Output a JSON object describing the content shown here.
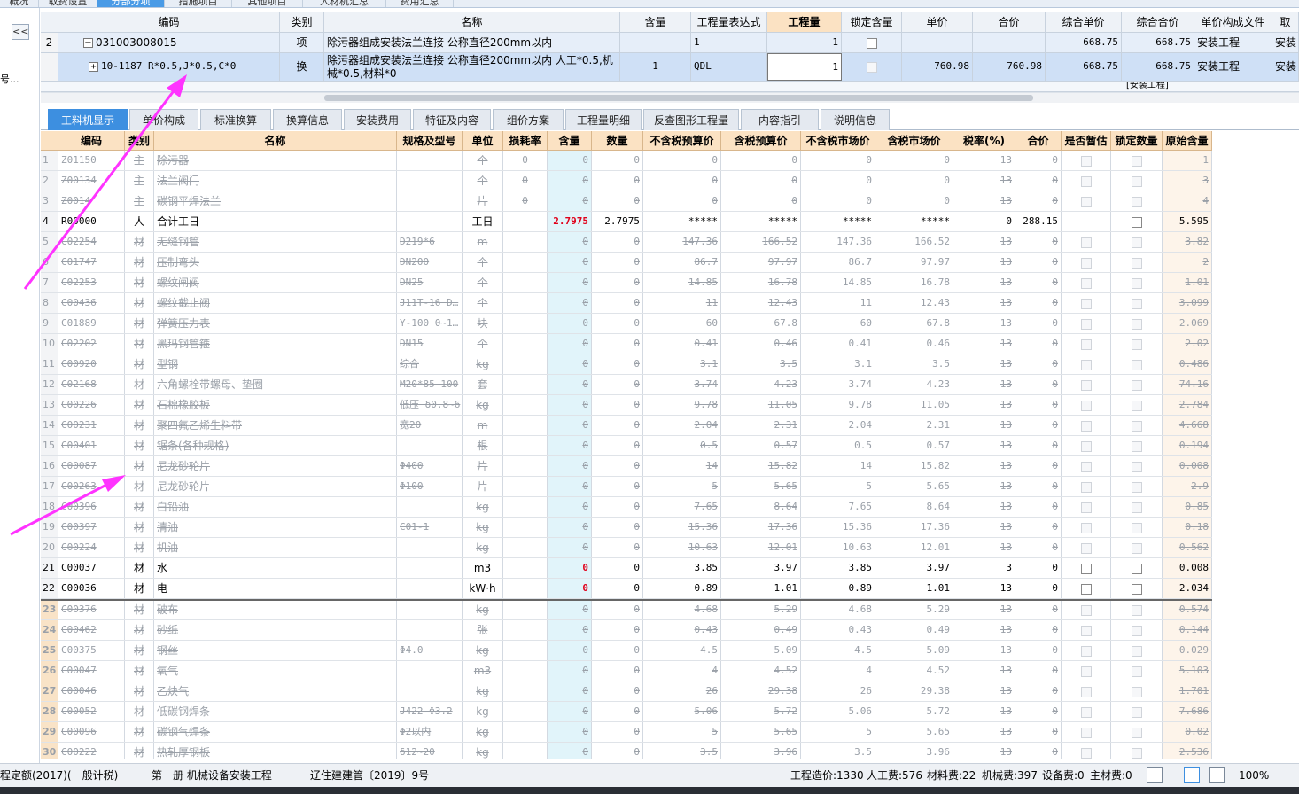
{
  "top_tabs": [
    "概况",
    "取费设置",
    "分部分项",
    "措施项目",
    "其他项目",
    "人材机汇总",
    "费用汇总"
  ],
  "left_panel": {
    "collapse_label": "<<",
    "side_text": "号..."
  },
  "upper_table": {
    "headers": [
      "编码",
      "类别",
      "名称",
      "含量",
      "工程量表达式",
      "工程量",
      "锁定含量",
      "单价",
      "合价",
      "综合单价",
      "综合合价",
      "单价构成文件",
      "取"
    ],
    "rows": [
      {
        "idx": "2",
        "code": "031003008015",
        "type": "项",
        "name": "除污器组成安装法兰连接 公称直径200mm以内",
        "qty_ratio": "",
        "expr": "1",
        "qty": "1",
        "unit_price": "",
        "total": "",
        "comp_unit": "668.75",
        "comp_total": "668.75",
        "file": "安装工程",
        "extra": "安装"
      },
      {
        "idx": "",
        "code": "10-1187 R*0.5,J*0.5,C*0",
        "type": "换",
        "name": "除污器组成安装法兰连接 公称直径200mm以内  人工*0.5,机械*0.5,材料*0",
        "qty_ratio": "1",
        "expr": "QDL",
        "qty": "1",
        "unit_price": "760.98",
        "total": "760.98",
        "comp_unit": "668.75",
        "comp_total": "668.75",
        "file": "安装工程",
        "extra": "安装"
      }
    ],
    "partial_row_text": "[安装工程]"
  },
  "lower_tabs": [
    "工料机显示",
    "单价构成",
    "标准换算",
    "换算信息",
    "安装费用",
    "特征及内容",
    "组价方案",
    "工程量明细",
    "反查图形工程量",
    "内容指引",
    "说明信息"
  ],
  "grid": {
    "headers": [
      "",
      "编码",
      "类别",
      "名称",
      "规格及型号",
      "单位",
      "损耗率",
      "含量",
      "数量",
      "不含税预算价",
      "含税预算价",
      "不含税市场价",
      "含税市场价",
      "税率(%)",
      "合价",
      "是否暂估",
      "锁定数量",
      "原始含量"
    ],
    "rows": [
      {
        "idx": "1",
        "code": "Z01150",
        "type": "主",
        "name": "除污器",
        "spec": "",
        "unit": "个",
        "loss": "0",
        "ratio": "0",
        "qty": "0",
        "bp": "0",
        "bpt": "0",
        "mp": "0",
        "mpt": "0",
        "tax": "13",
        "total": "0",
        "orig": "1",
        "faded": true,
        "bold_idx": false
      },
      {
        "idx": "2",
        "code": "Z00134",
        "type": "主",
        "name": "法兰阀门",
        "spec": "",
        "unit": "个",
        "loss": "0",
        "ratio": "0",
        "qty": "0",
        "bp": "0",
        "bpt": "0",
        "mp": "0",
        "mpt": "0",
        "tax": "13",
        "total": "0",
        "orig": "3",
        "faded": true,
        "bold_idx": false
      },
      {
        "idx": "3",
        "code": "Z0014",
        "type": "主",
        "name": "碳钢平焊法兰",
        "spec": "",
        "unit": "片",
        "loss": "0",
        "ratio": "0",
        "qty": "0",
        "bp": "0",
        "bpt": "0",
        "mp": "0",
        "mpt": "0",
        "tax": "13",
        "total": "0",
        "orig": "4",
        "faded": true,
        "bold_idx": false
      },
      {
        "idx": "4",
        "code": "R00000",
        "type": "人",
        "name": "合计工日",
        "spec": "",
        "unit": "工日",
        "loss": "",
        "ratio": "2.7975",
        "qty": "2.7975",
        "bp": "*****",
        "bpt": "*****",
        "mp": "*****",
        "mpt": "*****",
        "tax": "0",
        "total": "288.15",
        "orig": "5.595",
        "faded": false,
        "bold_idx": false,
        "ratio_red": true
      },
      {
        "idx": "5",
        "code": "C02254",
        "type": "材",
        "name": "无缝钢管",
        "spec": "D219*6",
        "unit": "m",
        "loss": "",
        "ratio": "0",
        "qty": "0",
        "bp": "147.36",
        "bpt": "166.52",
        "mp": "147.36",
        "mpt": "166.52",
        "tax": "13",
        "total": "0",
        "orig": "3.82",
        "faded": true,
        "bold_idx": false
      },
      {
        "idx": "6",
        "code": "C01747",
        "type": "材",
        "name": "压制弯头",
        "spec": "DN200",
        "unit": "个",
        "loss": "",
        "ratio": "0",
        "qty": "0",
        "bp": "86.7",
        "bpt": "97.97",
        "mp": "86.7",
        "mpt": "97.97",
        "tax": "13",
        "total": "0",
        "orig": "2",
        "faded": true,
        "bold_idx": false
      },
      {
        "idx": "7",
        "code": "C02253",
        "type": "材",
        "name": "螺纹闸阀",
        "spec": "DN25",
        "unit": "个",
        "loss": "",
        "ratio": "0",
        "qty": "0",
        "bp": "14.85",
        "bpt": "16.78",
        "mp": "14.85",
        "mpt": "16.78",
        "tax": "13",
        "total": "0",
        "orig": "1.01",
        "faded": true,
        "bold_idx": false
      },
      {
        "idx": "8",
        "code": "C00436",
        "type": "材",
        "name": "螺纹截止阀",
        "spec": "J11T-16 D…",
        "unit": "个",
        "loss": "",
        "ratio": "0",
        "qty": "0",
        "bp": "11",
        "bpt": "12.43",
        "mp": "11",
        "mpt": "12.43",
        "tax": "13",
        "total": "0",
        "orig": "3.099",
        "faded": true,
        "bold_idx": false
      },
      {
        "idx": "9",
        "code": "C01889",
        "type": "材",
        "name": "弹簧压力表",
        "spec": "Y-100 0~1…",
        "unit": "块",
        "loss": "",
        "ratio": "0",
        "qty": "0",
        "bp": "60",
        "bpt": "67.8",
        "mp": "60",
        "mpt": "67.8",
        "tax": "13",
        "total": "0",
        "orig": "2.069",
        "faded": true,
        "bold_idx": false
      },
      {
        "idx": "10",
        "code": "C02202",
        "type": "材",
        "name": "黑玛钢管箍",
        "spec": "DN15",
        "unit": "个",
        "loss": "",
        "ratio": "0",
        "qty": "0",
        "bp": "0.41",
        "bpt": "0.46",
        "mp": "0.41",
        "mpt": "0.46",
        "tax": "13",
        "total": "0",
        "orig": "2.02",
        "faded": true,
        "bold_idx": false
      },
      {
        "idx": "11",
        "code": "C00920",
        "type": "材",
        "name": "型钢",
        "spec": "综合",
        "unit": "kg",
        "loss": "",
        "ratio": "0",
        "qty": "0",
        "bp": "3.1",
        "bpt": "3.5",
        "mp": "3.1",
        "mpt": "3.5",
        "tax": "13",
        "total": "0",
        "orig": "0.486",
        "faded": true,
        "bold_idx": false
      },
      {
        "idx": "12",
        "code": "C02168",
        "type": "材",
        "name": "六角螺栓带螺母、垫圈",
        "spec": "M20*85~100",
        "unit": "套",
        "loss": "",
        "ratio": "0",
        "qty": "0",
        "bp": "3.74",
        "bpt": "4.23",
        "mp": "3.74",
        "mpt": "4.23",
        "tax": "13",
        "total": "0",
        "orig": "74.16",
        "faded": true,
        "bold_idx": false
      },
      {
        "idx": "13",
        "code": "C00226",
        "type": "材",
        "name": "石棉橡胶板",
        "spec": "低压 δ0.8~6",
        "unit": "kg",
        "loss": "",
        "ratio": "0",
        "qty": "0",
        "bp": "9.78",
        "bpt": "11.05",
        "mp": "9.78",
        "mpt": "11.05",
        "tax": "13",
        "total": "0",
        "orig": "2.784",
        "faded": true,
        "bold_idx": false
      },
      {
        "idx": "14",
        "code": "C00231",
        "type": "材",
        "name": "聚四氟乙烯生料带",
        "spec": "宽20",
        "unit": "m",
        "loss": "",
        "ratio": "0",
        "qty": "0",
        "bp": "2.04",
        "bpt": "2.31",
        "mp": "2.04",
        "mpt": "2.31",
        "tax": "13",
        "total": "0",
        "orig": "4.668",
        "faded": true,
        "bold_idx": false
      },
      {
        "idx": "15",
        "code": "C00401",
        "type": "材",
        "name": "锯条(各种规格)",
        "spec": "",
        "unit": "根",
        "loss": "",
        "ratio": "0",
        "qty": "0",
        "bp": "0.5",
        "bpt": "0.57",
        "mp": "0.5",
        "mpt": "0.57",
        "tax": "13",
        "total": "0",
        "orig": "0.194",
        "faded": true,
        "bold_idx": false
      },
      {
        "idx": "16",
        "code": "C00087",
        "type": "材",
        "name": "尼龙砂轮片",
        "spec": "Φ400",
        "unit": "片",
        "loss": "",
        "ratio": "0",
        "qty": "0",
        "bp": "14",
        "bpt": "15.82",
        "mp": "14",
        "mpt": "15.82",
        "tax": "13",
        "total": "0",
        "orig": "0.008",
        "faded": true,
        "bold_idx": false
      },
      {
        "idx": "17",
        "code": "C00263",
        "type": "材",
        "name": "尼龙砂轮片",
        "spec": "Φ100",
        "unit": "片",
        "loss": "",
        "ratio": "0",
        "qty": "0",
        "bp": "5",
        "bpt": "5.65",
        "mp": "5",
        "mpt": "5.65",
        "tax": "13",
        "total": "0",
        "orig": "2.9",
        "faded": true,
        "bold_idx": false
      },
      {
        "idx": "18",
        "code": "C00396",
        "type": "材",
        "name": "白铅油",
        "spec": "",
        "unit": "kg",
        "loss": "",
        "ratio": "0",
        "qty": "0",
        "bp": "7.65",
        "bpt": "8.64",
        "mp": "7.65",
        "mpt": "8.64",
        "tax": "13",
        "total": "0",
        "orig": "0.85",
        "faded": true,
        "bold_idx": false
      },
      {
        "idx": "19",
        "code": "C00397",
        "type": "材",
        "name": "清油",
        "spec": "C01-1",
        "unit": "kg",
        "loss": "",
        "ratio": "0",
        "qty": "0",
        "bp": "15.36",
        "bpt": "17.36",
        "mp": "15.36",
        "mpt": "17.36",
        "tax": "13",
        "total": "0",
        "orig": "0.18",
        "faded": true,
        "bold_idx": false
      },
      {
        "idx": "20",
        "code": "C00224",
        "type": "材",
        "name": "机油",
        "spec": "",
        "unit": "kg",
        "loss": "",
        "ratio": "0",
        "qty": "0",
        "bp": "10.63",
        "bpt": "12.01",
        "mp": "10.63",
        "mpt": "12.01",
        "tax": "13",
        "total": "0",
        "orig": "0.562",
        "faded": true,
        "bold_idx": false
      },
      {
        "idx": "21",
        "code": "C00037",
        "type": "材",
        "name": "水",
        "spec": "",
        "unit": "m3",
        "loss": "",
        "ratio": "0",
        "qty": "0",
        "bp": "3.85",
        "bpt": "3.97",
        "mp": "3.85",
        "mpt": "3.97",
        "tax": "3",
        "total": "0",
        "orig": "0.008",
        "faded": false,
        "bold_idx": false,
        "ratio_red": true
      },
      {
        "idx": "22",
        "code": "C00036",
        "type": "材",
        "name": "电",
        "spec": "",
        "unit": "kW·h",
        "loss": "",
        "ratio": "0",
        "qty": "0",
        "bp": "0.89",
        "bpt": "1.01",
        "mp": "0.89",
        "mpt": "1.01",
        "tax": "13",
        "total": "0",
        "orig": "2.034",
        "faded": false,
        "bold_idx": false,
        "ratio_red": true
      },
      {
        "idx": "23",
        "code": "C00376",
        "type": "材",
        "name": "破布",
        "spec": "",
        "unit": "kg",
        "loss": "",
        "ratio": "0",
        "qty": "0",
        "bp": "4.68",
        "bpt": "5.29",
        "mp": "4.68",
        "mpt": "5.29",
        "tax": "13",
        "total": "0",
        "orig": "0.574",
        "faded": true,
        "bold_idx": true
      },
      {
        "idx": "24",
        "code": "C00462",
        "type": "材",
        "name": "砂纸",
        "spec": "",
        "unit": "张",
        "loss": "",
        "ratio": "0",
        "qty": "0",
        "bp": "0.43",
        "bpt": "0.49",
        "mp": "0.43",
        "mpt": "0.49",
        "tax": "13",
        "total": "0",
        "orig": "0.144",
        "faded": true,
        "bold_idx": true
      },
      {
        "idx": "25",
        "code": "C00375",
        "type": "材",
        "name": "钢丝",
        "spec": "Φ4.0",
        "unit": "kg",
        "loss": "",
        "ratio": "0",
        "qty": "0",
        "bp": "4.5",
        "bpt": "5.09",
        "mp": "4.5",
        "mpt": "5.09",
        "tax": "13",
        "total": "0",
        "orig": "0.029",
        "faded": true,
        "bold_idx": true
      },
      {
        "idx": "26",
        "code": "C00047",
        "type": "材",
        "name": "氧气",
        "spec": "",
        "unit": "m3",
        "loss": "",
        "ratio": "0",
        "qty": "0",
        "bp": "4",
        "bpt": "4.52",
        "mp": "4",
        "mpt": "4.52",
        "tax": "13",
        "total": "0",
        "orig": "5.103",
        "faded": true,
        "bold_idx": true
      },
      {
        "idx": "27",
        "code": "C00046",
        "type": "材",
        "name": "乙炔气",
        "spec": "",
        "unit": "kg",
        "loss": "",
        "ratio": "0",
        "qty": "0",
        "bp": "26",
        "bpt": "29.38",
        "mp": "26",
        "mpt": "29.38",
        "tax": "13",
        "total": "0",
        "orig": "1.701",
        "faded": true,
        "bold_idx": true
      },
      {
        "idx": "28",
        "code": "C00052",
        "type": "材",
        "name": "低碳钢焊条",
        "spec": "J422 Φ3.2",
        "unit": "kg",
        "loss": "",
        "ratio": "0",
        "qty": "0",
        "bp": "5.06",
        "bpt": "5.72",
        "mp": "5.06",
        "mpt": "5.72",
        "tax": "13",
        "total": "0",
        "orig": "7.686",
        "faded": true,
        "bold_idx": true
      },
      {
        "idx": "29",
        "code": "C00096",
        "type": "材",
        "name": "碳钢气焊条",
        "spec": "Φ2以内",
        "unit": "kg",
        "loss": "",
        "ratio": "0",
        "qty": "0",
        "bp": "5",
        "bpt": "5.65",
        "mp": "5",
        "mpt": "5.65",
        "tax": "13",
        "total": "0",
        "orig": "0.02",
        "faded": true,
        "bold_idx": true
      },
      {
        "idx": "30",
        "code": "C00222",
        "type": "材",
        "name": "热轧厚钢板",
        "spec": "δ12~20",
        "unit": "kg",
        "loss": "",
        "ratio": "0",
        "qty": "0",
        "bp": "3.5",
        "bpt": "3.96",
        "mp": "3.5",
        "mpt": "3.96",
        "tax": "13",
        "total": "0",
        "orig": "2.536",
        "faded": true,
        "bold_idx": true
      }
    ]
  },
  "status_bar": {
    "quota": "程定额(2017)(一般计税)",
    "volume": "第一册 机械设备安装工程",
    "doc": "辽住建建管〔2019〕9号",
    "cost": "工程造价:1330",
    "labor": "人工费:576",
    "material": "材料费:22",
    "machine": "机械费:397",
    "equipment": "设备费:0",
    "main_material": "主材费:0",
    "zoom": "100%"
  },
  "colors": {
    "accent": "#3d8fe0",
    "header_bg": "#fbe2c3",
    "annotation": "#ff33ff",
    "negative": "#e0001a"
  }
}
